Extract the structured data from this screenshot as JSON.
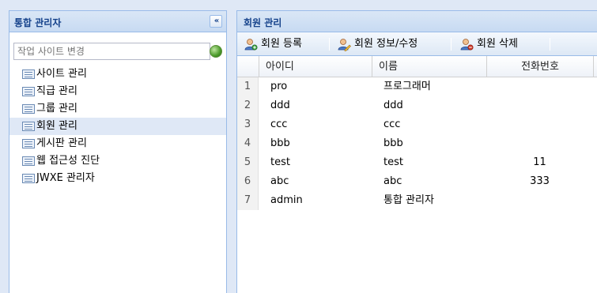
{
  "left_panel": {
    "title": "통합 관리자",
    "collapse_label": "«",
    "site_select_placeholder": "작업 사이트 변경",
    "menu_items": [
      {
        "label": "사이트 관리"
      },
      {
        "label": "직급 관리"
      },
      {
        "label": "그룹 관리"
      },
      {
        "label": "회원 관리",
        "selected": true
      },
      {
        "label": "게시판 관리"
      },
      {
        "label": "웹 접근성 진단"
      },
      {
        "label": "JWXE 관리자"
      }
    ]
  },
  "right_panel": {
    "title": "회원 관리",
    "toolbar": {
      "register_label": "회원 등록",
      "edit_label": "회원 정보/수정",
      "delete_label": "회원 삭제"
    },
    "grid": {
      "columns": [
        "아이디",
        "이름",
        "전화번호"
      ],
      "rows": [
        {
          "num": "1",
          "id": "pro",
          "name": "프로그래머",
          "phone": ""
        },
        {
          "num": "2",
          "id": "ddd",
          "name": "ddd",
          "phone": ""
        },
        {
          "num": "3",
          "id": "ccc",
          "name": "ccc",
          "phone": ""
        },
        {
          "num": "4",
          "id": "bbb",
          "name": "bbb",
          "phone": ""
        },
        {
          "num": "5",
          "id": "test",
          "name": "test",
          "phone": "11"
        },
        {
          "num": "6",
          "id": "abc",
          "name": "abc",
          "phone": "333"
        },
        {
          "num": "7",
          "id": "admin",
          "name": "통합 관리자",
          "phone": ""
        }
      ]
    }
  },
  "colors": {
    "header_text": "#15428b",
    "border": "#99bbe8",
    "selected_row": "#dfe8f6"
  },
  "icons": {
    "collapse": "double-chevron-left-icon",
    "site_select": "globe-icon",
    "menu_item": "list-icon",
    "register": "user-add-icon",
    "edit": "user-edit-icon",
    "delete": "user-delete-icon"
  }
}
